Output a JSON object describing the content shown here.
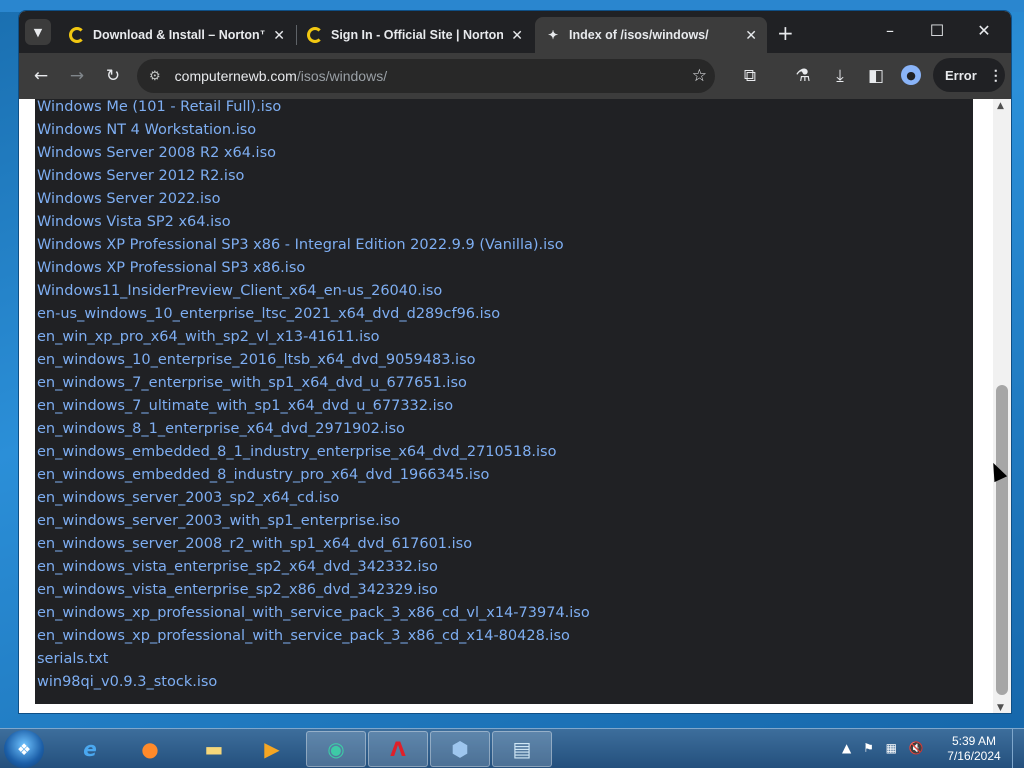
{
  "browser": {
    "tabs": [
      {
        "title": "Download & Install – Norton™",
        "active": false
      },
      {
        "title": "Sign In - Official Site | Norton",
        "active": false
      },
      {
        "title": "Index of /isos/windows/",
        "active": true
      }
    ],
    "new_tab_label": "+",
    "close_label": "✕",
    "url_host": "computernewb.com",
    "url_path": "/isos/windows/",
    "error_chip_label": "Error"
  },
  "listing": {
    "files": [
      "Windows Me (101 - Retail Full).iso",
      "Windows NT 4 Workstation.iso",
      "Windows Server 2008 R2 x64.iso",
      "Windows Server 2012 R2.iso",
      "Windows Server 2022.iso",
      "Windows Vista SP2 x64.iso",
      "Windows XP Professional SP3 x86 - Integral Edition 2022.9.9 (Vanilla).iso",
      "Windows XP Professional SP3 x86.iso",
      "Windows11_InsiderPreview_Client_x64_en-us_26040.iso",
      "en-us_windows_10_enterprise_ltsc_2021_x64_dvd_d289cf96.iso",
      "en_win_xp_pro_x64_with_sp2_vl_x13-41611.iso",
      "en_windows_10_enterprise_2016_ltsb_x64_dvd_9059483.iso",
      "en_windows_7_enterprise_with_sp1_x64_dvd_u_677651.iso",
      "en_windows_7_ultimate_with_sp1_x64_dvd_u_677332.iso",
      "en_windows_8_1_enterprise_x64_dvd_2971902.iso",
      "en_windows_embedded_8_1_industry_enterprise_x64_dvd_2710518.iso",
      "en_windows_embedded_8_industry_pro_x64_dvd_1966345.iso",
      "en_windows_server_2003_sp2_x64_cd.iso",
      "en_windows_server_2003_with_sp1_enterprise.iso",
      "en_windows_server_2008_r2_with_sp1_x64_dvd_617601.iso",
      "en_windows_vista_enterprise_sp2_x64_dvd_342332.iso",
      "en_windows_vista_enterprise_sp2_x86_dvd_342329.iso",
      "en_windows_xp_professional_with_service_pack_3_x86_cd_vl_x14-73974.iso",
      "en_windows_xp_professional_with_service_pack_3_x86_cd_x14-80428.iso",
      "serials.txt",
      "win98qi_v0.9.3_stock.iso"
    ]
  },
  "taskbar": {
    "apps": [
      "internet-explorer",
      "firefox",
      "file-explorer",
      "media-player",
      "chrome-like-browser",
      "avira",
      "virtualbox",
      "notepad"
    ],
    "clock_time": "5:39 AM",
    "clock_date": "7/16/2024"
  },
  "colors": {
    "link": "#7eaef2",
    "listing_bg": "#202124",
    "chrome_dark": "#202124",
    "toolbar": "#3c3c3c"
  }
}
